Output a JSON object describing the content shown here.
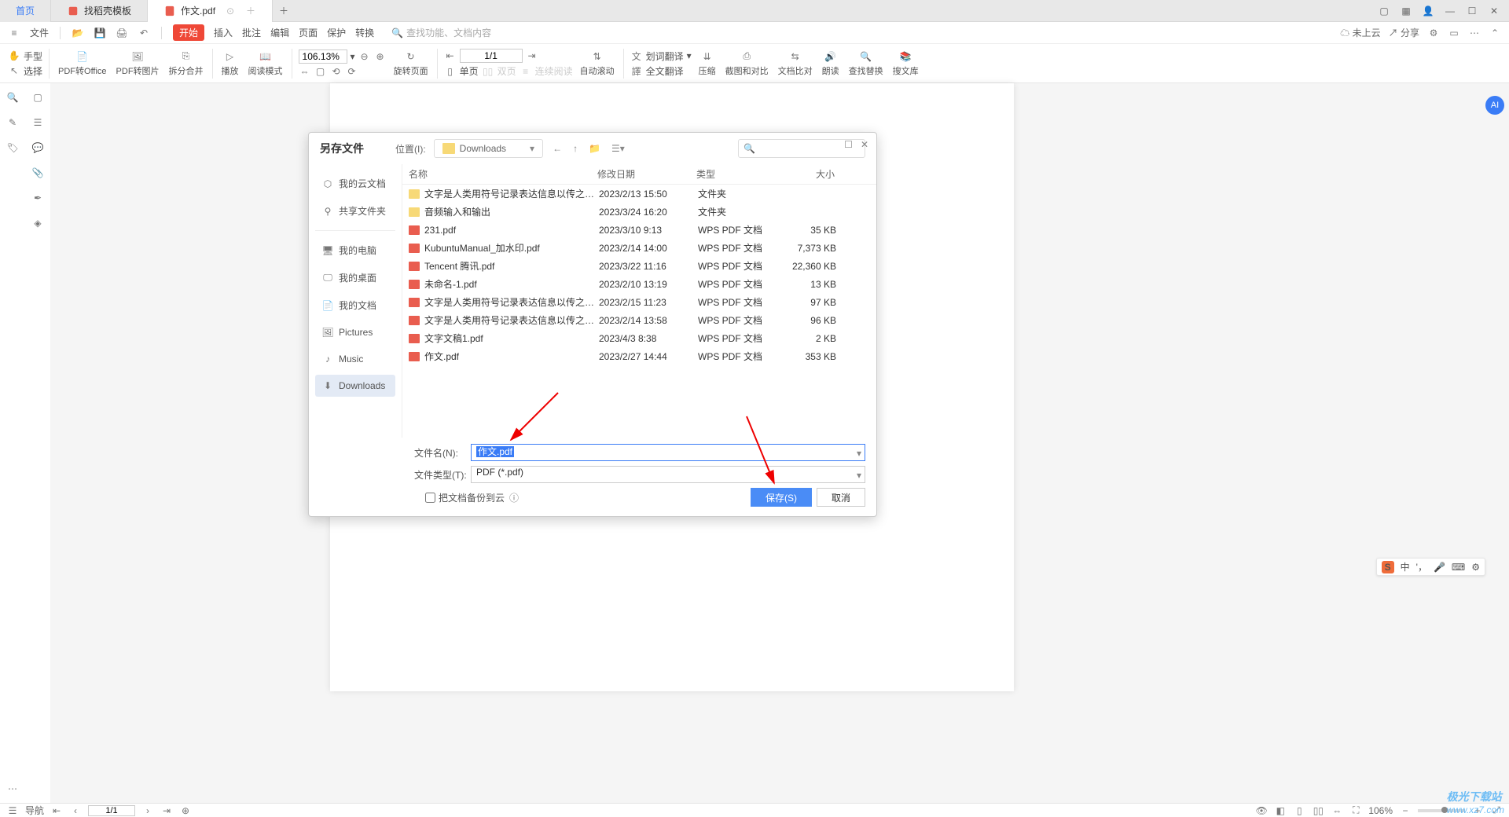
{
  "tabs": {
    "home": "首页",
    "t1": "找稻壳模板",
    "t2": "作文.pdf"
  },
  "menu": {
    "file": "文件",
    "start": "开始",
    "insert": "插入",
    "annotate": "批注",
    "edit": "编辑",
    "page": "页面",
    "protect": "保护",
    "convert": "转换",
    "search_placeholder": "查找功能、文档内容",
    "cloud": "未上云",
    "share": "分享"
  },
  "toolbar_left": {
    "hand": "手型",
    "select": "选择"
  },
  "toolbar": {
    "pdf2office": "PDF转Office",
    "pdf2img": "PDF转图片",
    "split": "拆分合并",
    "play": "播放",
    "readmode": "阅读模式",
    "zoom_value": "106.13%",
    "rotate": "旋转页面",
    "single": "单页",
    "double": "双页",
    "contread": "连续阅读",
    "autoscroll": "自动滚动",
    "page_value": "1/1",
    "translate_word": "划词翻译",
    "translate_full": "全文翻译",
    "compress": "压缩",
    "screenshot_compare": "截图和对比",
    "doc_compare": "文档比对",
    "read_aloud": "朗读",
    "find_replace": "查找替换",
    "search_lib": "搜文库"
  },
  "dialog": {
    "title": "另存文件",
    "location_label": "位置(I):",
    "location_value": "Downloads",
    "sidebar": {
      "cloud": "我的云文档",
      "share": "共享文件夹",
      "computer": "我的电脑",
      "desktop": "我的桌面",
      "documents": "我的文档",
      "pictures": "Pictures",
      "music": "Music",
      "downloads": "Downloads"
    },
    "cols": {
      "name": "名称",
      "date": "修改日期",
      "type": "类型",
      "size": "大小"
    },
    "files": [
      {
        "name": "文字是人类用符号记录表达信息以传之久远的方式...",
        "date": "2023/2/13 15:50",
        "type": "文件夹",
        "size": "",
        "folder": true
      },
      {
        "name": "音频输入和输出",
        "date": "2023/3/24 16:20",
        "type": "文件夹",
        "size": "",
        "folder": true
      },
      {
        "name": "231.pdf",
        "date": "2023/3/10 9:13",
        "type": "WPS PDF 文档",
        "size": "35 KB",
        "folder": false
      },
      {
        "name": "KubuntuManual_加水印.pdf",
        "date": "2023/2/14 14:00",
        "type": "WPS PDF 文档",
        "size": "7,373 KB",
        "folder": false
      },
      {
        "name": "Tencent 腾讯.pdf",
        "date": "2023/3/22 11:16",
        "type": "WPS PDF 文档",
        "size": "22,360 KB",
        "folder": false
      },
      {
        "name": "未命名-1.pdf",
        "date": "2023/2/10 13:19",
        "type": "WPS PDF 文档",
        "size": "13 KB",
        "folder": false
      },
      {
        "name": "文字是人类用符号记录表达信息以传之久远的方式...",
        "date": "2023/2/15 11:23",
        "type": "WPS PDF 文档",
        "size": "97 KB",
        "folder": false
      },
      {
        "name": "文字是人类用符号记录表达信息以传之久远的方式...",
        "date": "2023/2/14 13:58",
        "type": "WPS PDF 文档",
        "size": "96 KB",
        "folder": false
      },
      {
        "name": "文字文稿1.pdf",
        "date": "2023/4/3 8:38",
        "type": "WPS PDF 文档",
        "size": "2 KB",
        "folder": false
      },
      {
        "name": "作文.pdf",
        "date": "2023/2/27 14:44",
        "type": "WPS PDF 文档",
        "size": "353 KB",
        "folder": false
      }
    ],
    "filename_label": "文件名(N):",
    "filename_value": "作文.pdf",
    "filetype_label": "文件类型(T):",
    "filetype_value": "PDF (*.pdf)",
    "backup_label": "把文档备份到云",
    "save": "保存(S)",
    "cancel": "取消"
  },
  "status": {
    "nav": "导航",
    "page": "1/1",
    "zoom": "106%"
  },
  "float": {
    "zh": "中"
  },
  "watermark": {
    "brand": "极光下载站",
    "url": "www.xz7.com"
  }
}
